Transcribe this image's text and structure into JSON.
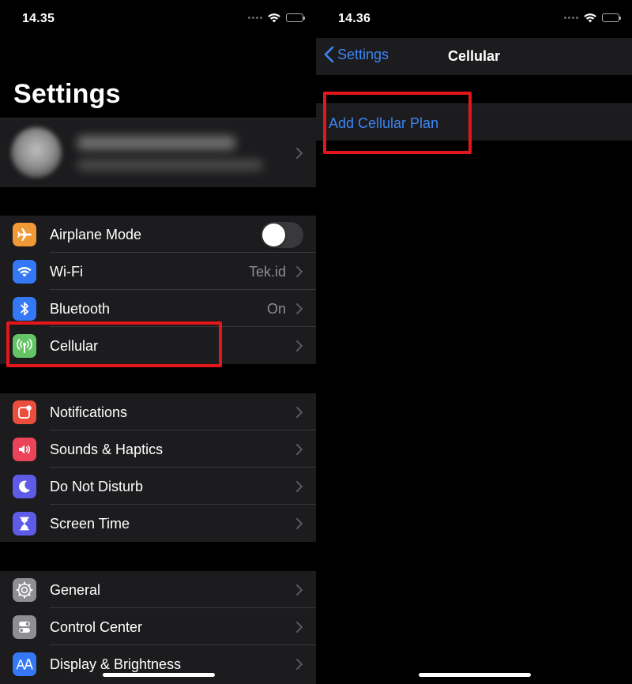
{
  "left_screen": {
    "status": {
      "time": "14.35"
    },
    "title": "Settings",
    "groups": [
      {
        "rows": [
          {
            "label": "Airplane Mode",
            "icon": "airplane-icon",
            "icon_color": "#f09a37",
            "toggle": "off"
          },
          {
            "label": "Wi-Fi",
            "icon": "wifi-icon",
            "icon_color": "#3478f6",
            "value": "Tek.id"
          },
          {
            "label": "Bluetooth",
            "icon": "bluetooth-icon",
            "icon_color": "#3478f6",
            "value": "On"
          },
          {
            "label": "Cellular",
            "icon": "antenna-icon",
            "icon_color": "#65c466",
            "value": ""
          }
        ]
      },
      {
        "rows": [
          {
            "label": "Notifications",
            "icon": "notifications-icon",
            "icon_color": "#eb4e3d"
          },
          {
            "label": "Sounds & Haptics",
            "icon": "speaker-icon",
            "icon_color": "#eb445a"
          },
          {
            "label": "Do Not Disturb",
            "icon": "moon-icon",
            "icon_color": "#5e5ce6"
          },
          {
            "label": "Screen Time",
            "icon": "hourglass-icon",
            "icon_color": "#5e5ce6"
          }
        ]
      },
      {
        "rows": [
          {
            "label": "General",
            "icon": "gear-icon",
            "icon_color": "#8e8e93"
          },
          {
            "label": "Control Center",
            "icon": "switches-icon",
            "icon_color": "#8e8e93"
          },
          {
            "label": "Display & Brightness",
            "icon": "text-size-icon",
            "icon_color": "#3478f6"
          }
        ]
      }
    ]
  },
  "right_screen": {
    "status": {
      "time": "14.36"
    },
    "nav": {
      "back_label": "Settings",
      "title": "Cellular"
    },
    "add_plan_label": "Add Cellular Plan"
  },
  "colors": {
    "background": "#000000",
    "cell": "#1c1c1e",
    "separator": "#38383a",
    "link": "#3d86f6",
    "secondary_text": "#8e8e93",
    "highlight": "#e3171b"
  }
}
